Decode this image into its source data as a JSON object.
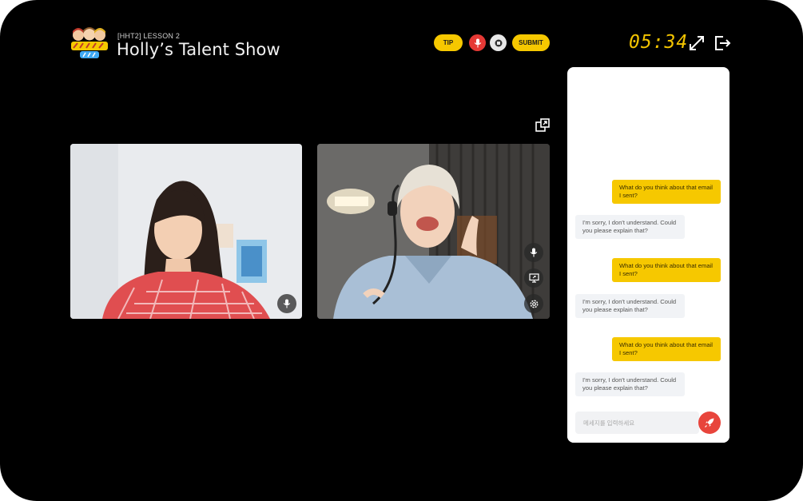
{
  "header": {
    "lesson_tag": "[HHT2] LESSON 2",
    "lesson_title": "Holly’s Talent Show",
    "tip_label": "TIP",
    "submit_label": "SUBMIT",
    "timer": "05:34"
  },
  "colors": {
    "accent": "#f6c800",
    "record_red": "#e53935",
    "send_red": "#e8453c"
  },
  "icons": {
    "logo": "holly-hodge-and-tony-logo",
    "mic": "microphone-icon",
    "stop": "stop-icon",
    "expand": "expand-arrows-icon",
    "exit": "exit-door-icon",
    "popout": "pop-out-icon",
    "screen": "screen-share-icon",
    "settings": "gear-icon",
    "send": "rocket-icon"
  },
  "chat": {
    "messages": [
      {
        "from": "user",
        "text": "What do you think about that email I sent?"
      },
      {
        "from": "bot",
        "text": "I'm sorry, I don't understand. Could you please explain that?"
      },
      {
        "from": "user",
        "text": "What do you think about that email I sent?"
      },
      {
        "from": "bot",
        "text": "I'm sorry, I don't understand. Could you please explain that?"
      },
      {
        "from": "user",
        "text": "What do you think about that email I sent?"
      },
      {
        "from": "bot",
        "text": "I'm sorry, I don't understand. Could you please explain that?"
      }
    ],
    "input_placeholder": "메세지를 입력하세요"
  }
}
